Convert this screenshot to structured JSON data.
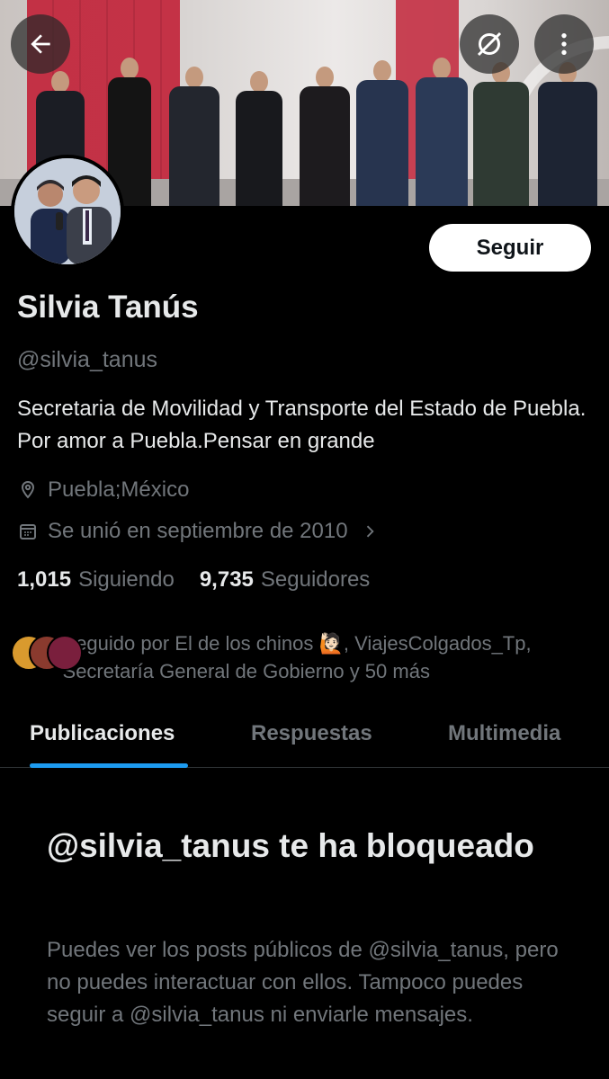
{
  "header": {
    "back_icon": "arrow-left-icon",
    "grok_icon": "slashed-circle-icon",
    "more_icon": "vertical-dots-icon"
  },
  "profile": {
    "name": "Silvia Tanús",
    "handle": "@silvia_tanus",
    "bio": "Secretaria de Movilidad y Transporte del Estado de Puebla. Por amor a Puebla.Pensar en grande",
    "location": "Puebla;México",
    "joined": "Se unió en septiembre de 2010",
    "follow_label": "Seguir",
    "following_count": "1,015",
    "following_label": "Siguiendo",
    "followers_count": "9,735",
    "followers_label": "Seguidores"
  },
  "followed_by": {
    "text": "Seguido por El de los chinos 🙋🏻, ViajesColgados_Tp, Secretaría General de Gobierno y 50 más"
  },
  "tabs": [
    {
      "label": "Publicaciones",
      "active": true
    },
    {
      "label": "Respuestas",
      "active": false
    },
    {
      "label": "Multimedia",
      "active": false
    }
  ],
  "blocked": {
    "title": "@silvia_tanus te ha bloqueado",
    "body": "Puedes ver los posts públicos de @silvia_tanus, pero no puedes interactuar con ellos. Tampoco puedes seguir a @silvia_tanus ni enviarle mensajes."
  },
  "colors": {
    "background": "#000000",
    "accent": "#1d9bf0",
    "muted_text": "#71767b",
    "primary_text": "#e7e9ea"
  }
}
